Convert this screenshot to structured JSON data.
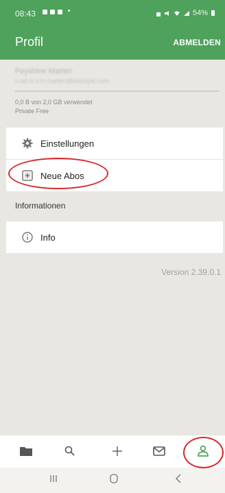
{
  "status_bar": {
    "time": "08:43",
    "battery": "54%"
  },
  "header": {
    "title": "Profil",
    "logout_label": "ABMELDEN"
  },
  "account": {
    "name": "Peyshtne Marten",
    "email": "u.ad.m.v.m.marten@example.com",
    "usage_fraction": 0.0,
    "usage_text": "0,0 B von 2,0 GB verwendet",
    "plan": "Private Free"
  },
  "menu": {
    "items": [
      {
        "label": "Einstellungen",
        "icon": "gear-icon"
      },
      {
        "label": "Neue Abos",
        "icon": "plus-box-icon"
      }
    ]
  },
  "info_section": {
    "title": "Informationen",
    "items": [
      {
        "label": "Info",
        "icon": "info-icon"
      }
    ]
  },
  "footer": {
    "version": "Version 2.39.0.1"
  },
  "bottom_nav": {
    "items": [
      {
        "name": "files-tab",
        "icon": "folder-icon"
      },
      {
        "name": "search-tab",
        "icon": "search-icon"
      },
      {
        "name": "add-tab",
        "icon": "plus-icon"
      },
      {
        "name": "messages-tab",
        "icon": "envelope-icon"
      },
      {
        "name": "profile-tab",
        "icon": "person-icon",
        "active": true
      }
    ],
    "active_color": "#4ea25b"
  },
  "colors": {
    "accent": "#4ea25b",
    "annotation": "#d9262b"
  }
}
